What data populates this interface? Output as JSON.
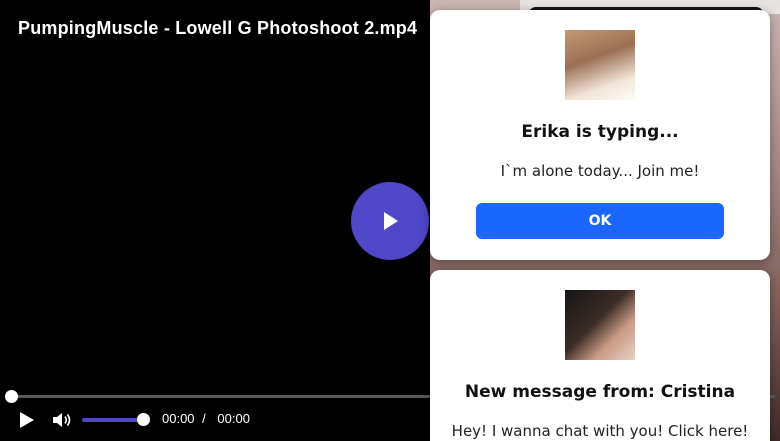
{
  "player": {
    "title": "PumpingMuscle - Lowell G Photoshoot 2.mp4",
    "current_time": "00:00",
    "time_separator": "/",
    "duration": "00:00",
    "progress_fraction": 0.0,
    "volume_fraction": 1.0,
    "accent_color": "#4f46c8",
    "icons": {
      "big_play": "play-icon",
      "play": "play-icon",
      "volume": "volume-icon"
    }
  },
  "notifications": [
    {
      "title": "Erika is typing...",
      "message": "I`m alone today... Join me!",
      "button_label": "OK",
      "button_color": "#1a66ff"
    },
    {
      "title": "New message from: Cristina",
      "message": "Hey! I wanna chat with you! Click here!"
    }
  ]
}
